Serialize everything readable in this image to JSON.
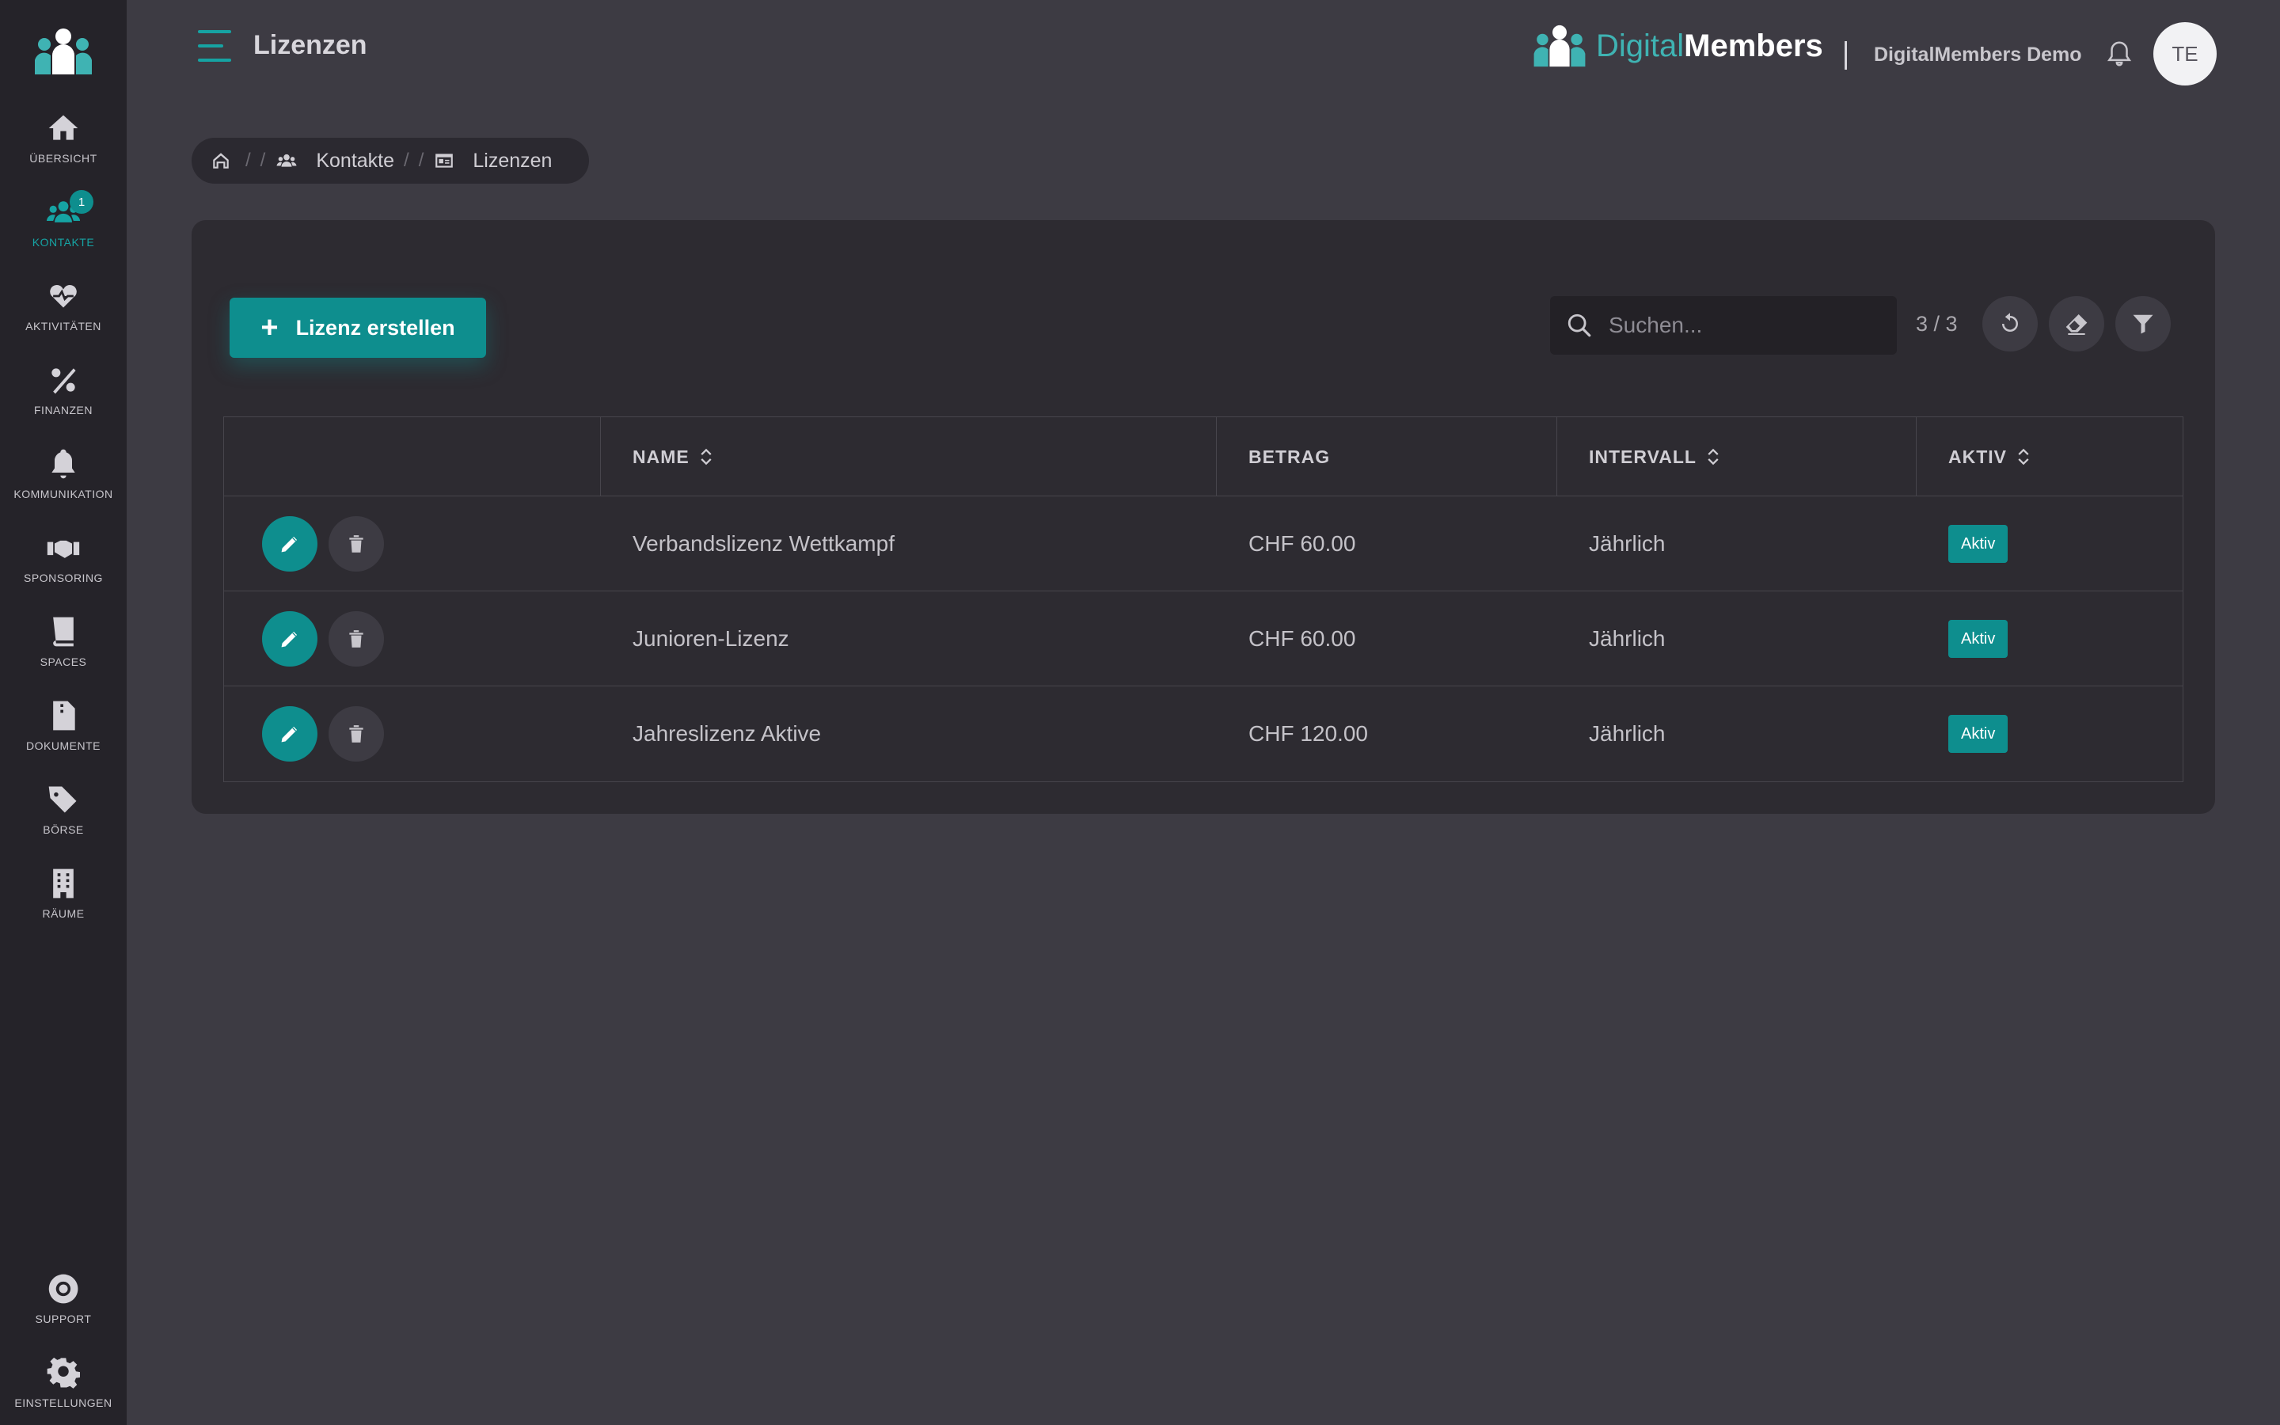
{
  "sidebar": {
    "items": [
      {
        "label": "ÜBERSICHT",
        "icon": "home-icon"
      },
      {
        "label": "KONTAKTE",
        "icon": "users-icon",
        "badge": "1",
        "active": true
      },
      {
        "label": "AKTIVITÄTEN",
        "icon": "heart-pulse-icon"
      },
      {
        "label": "FINANZEN",
        "icon": "percent-icon"
      },
      {
        "label": "KOMMUNIKATION",
        "icon": "bell-icon"
      },
      {
        "label": "SPONSORING",
        "icon": "handshake-icon"
      },
      {
        "label": "SPACES",
        "icon": "book-icon"
      },
      {
        "label": "DOKUMENTE",
        "icon": "file-archive-icon"
      },
      {
        "label": "BÖRSE",
        "icon": "tags-icon"
      },
      {
        "label": "RÄUME",
        "icon": "building-icon"
      }
    ],
    "bottom": [
      {
        "label": "SUPPORT",
        "icon": "life-ring-icon"
      },
      {
        "label": "EINSTELLUNGEN",
        "icon": "gear-icon"
      }
    ]
  },
  "header": {
    "title": "Lizenzen",
    "brand_digital": "Digital",
    "brand_members": "Members",
    "org_name": "DigitalMembers Demo",
    "avatar_initials": "TE"
  },
  "breadcrumb": {
    "items": [
      "Kontakte",
      "Lizenzen"
    ]
  },
  "toolbar": {
    "create_label": "Lizenz erstellen",
    "search_placeholder": "Suchen...",
    "count": "3 / 3"
  },
  "table": {
    "columns": [
      "NAME",
      "BETRAG",
      "INTERVALL",
      "AKTIV"
    ],
    "rows": [
      {
        "name": "Verbandslizenz Wettkampf",
        "betrag": "CHF 60.00",
        "intervall": "Jährlich",
        "aktiv": "Aktiv"
      },
      {
        "name": "Junioren-Lizenz",
        "betrag": "CHF 60.00",
        "intervall": "Jährlich",
        "aktiv": "Aktiv"
      },
      {
        "name": "Jahreslizenz Aktive",
        "betrag": "CHF 120.00",
        "intervall": "Jährlich",
        "aktiv": "Aktiv"
      }
    ]
  },
  "colors": {
    "accent": "#0e8e8e",
    "background": "#3d3b43",
    "sidebar": "#252329",
    "card": "#2d2b31"
  }
}
